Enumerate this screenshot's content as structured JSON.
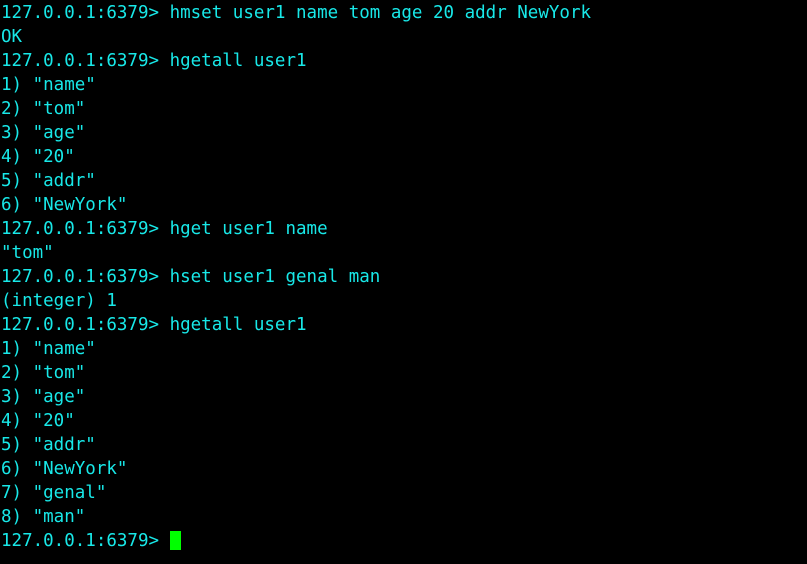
{
  "terminal": {
    "app": "redis-cli",
    "background_color": "#000000",
    "text_color": "#18e8e8",
    "cursor_color": "#00ff00",
    "prompt": "127.0.0.1:6379> ",
    "cursor_char": "",
    "lines": [
      {
        "type": "command",
        "prompt": "127.0.0.1:6379> ",
        "text": "hmset user1 name tom age 20 addr NewYork"
      },
      {
        "type": "reply",
        "prompt": "",
        "text": "OK"
      },
      {
        "type": "command",
        "prompt": "127.0.0.1:6379> ",
        "text": "hgetall user1"
      },
      {
        "type": "reply",
        "prompt": "",
        "text": "1) \"name\""
      },
      {
        "type": "reply",
        "prompt": "",
        "text": "2) \"tom\""
      },
      {
        "type": "reply",
        "prompt": "",
        "text": "3) \"age\""
      },
      {
        "type": "reply",
        "prompt": "",
        "text": "4) \"20\""
      },
      {
        "type": "reply",
        "prompt": "",
        "text": "5) \"addr\""
      },
      {
        "type": "reply",
        "prompt": "",
        "text": "6) \"NewYork\""
      },
      {
        "type": "command",
        "prompt": "127.0.0.1:6379> ",
        "text": "hget user1 name"
      },
      {
        "type": "reply",
        "prompt": "",
        "text": "\"tom\""
      },
      {
        "type": "command",
        "prompt": "127.0.0.1:6379> ",
        "text": "hset user1 genal man"
      },
      {
        "type": "reply",
        "prompt": "",
        "text": "(integer) 1"
      },
      {
        "type": "command",
        "prompt": "127.0.0.1:6379> ",
        "text": "hgetall user1"
      },
      {
        "type": "reply",
        "prompt": "",
        "text": "1) \"name\""
      },
      {
        "type": "reply",
        "prompt": "",
        "text": "2) \"tom\""
      },
      {
        "type": "reply",
        "prompt": "",
        "text": "3) \"age\""
      },
      {
        "type": "reply",
        "prompt": "",
        "text": "4) \"20\""
      },
      {
        "type": "reply",
        "prompt": "",
        "text": "5) \"addr\""
      },
      {
        "type": "reply",
        "prompt": "",
        "text": "6) \"NewYork\""
      },
      {
        "type": "reply",
        "prompt": "",
        "text": "7) \"genal\""
      },
      {
        "type": "reply",
        "prompt": "",
        "text": "8) \"man\""
      },
      {
        "type": "input",
        "prompt": "127.0.0.1:6379> ",
        "text": ""
      }
    ]
  }
}
